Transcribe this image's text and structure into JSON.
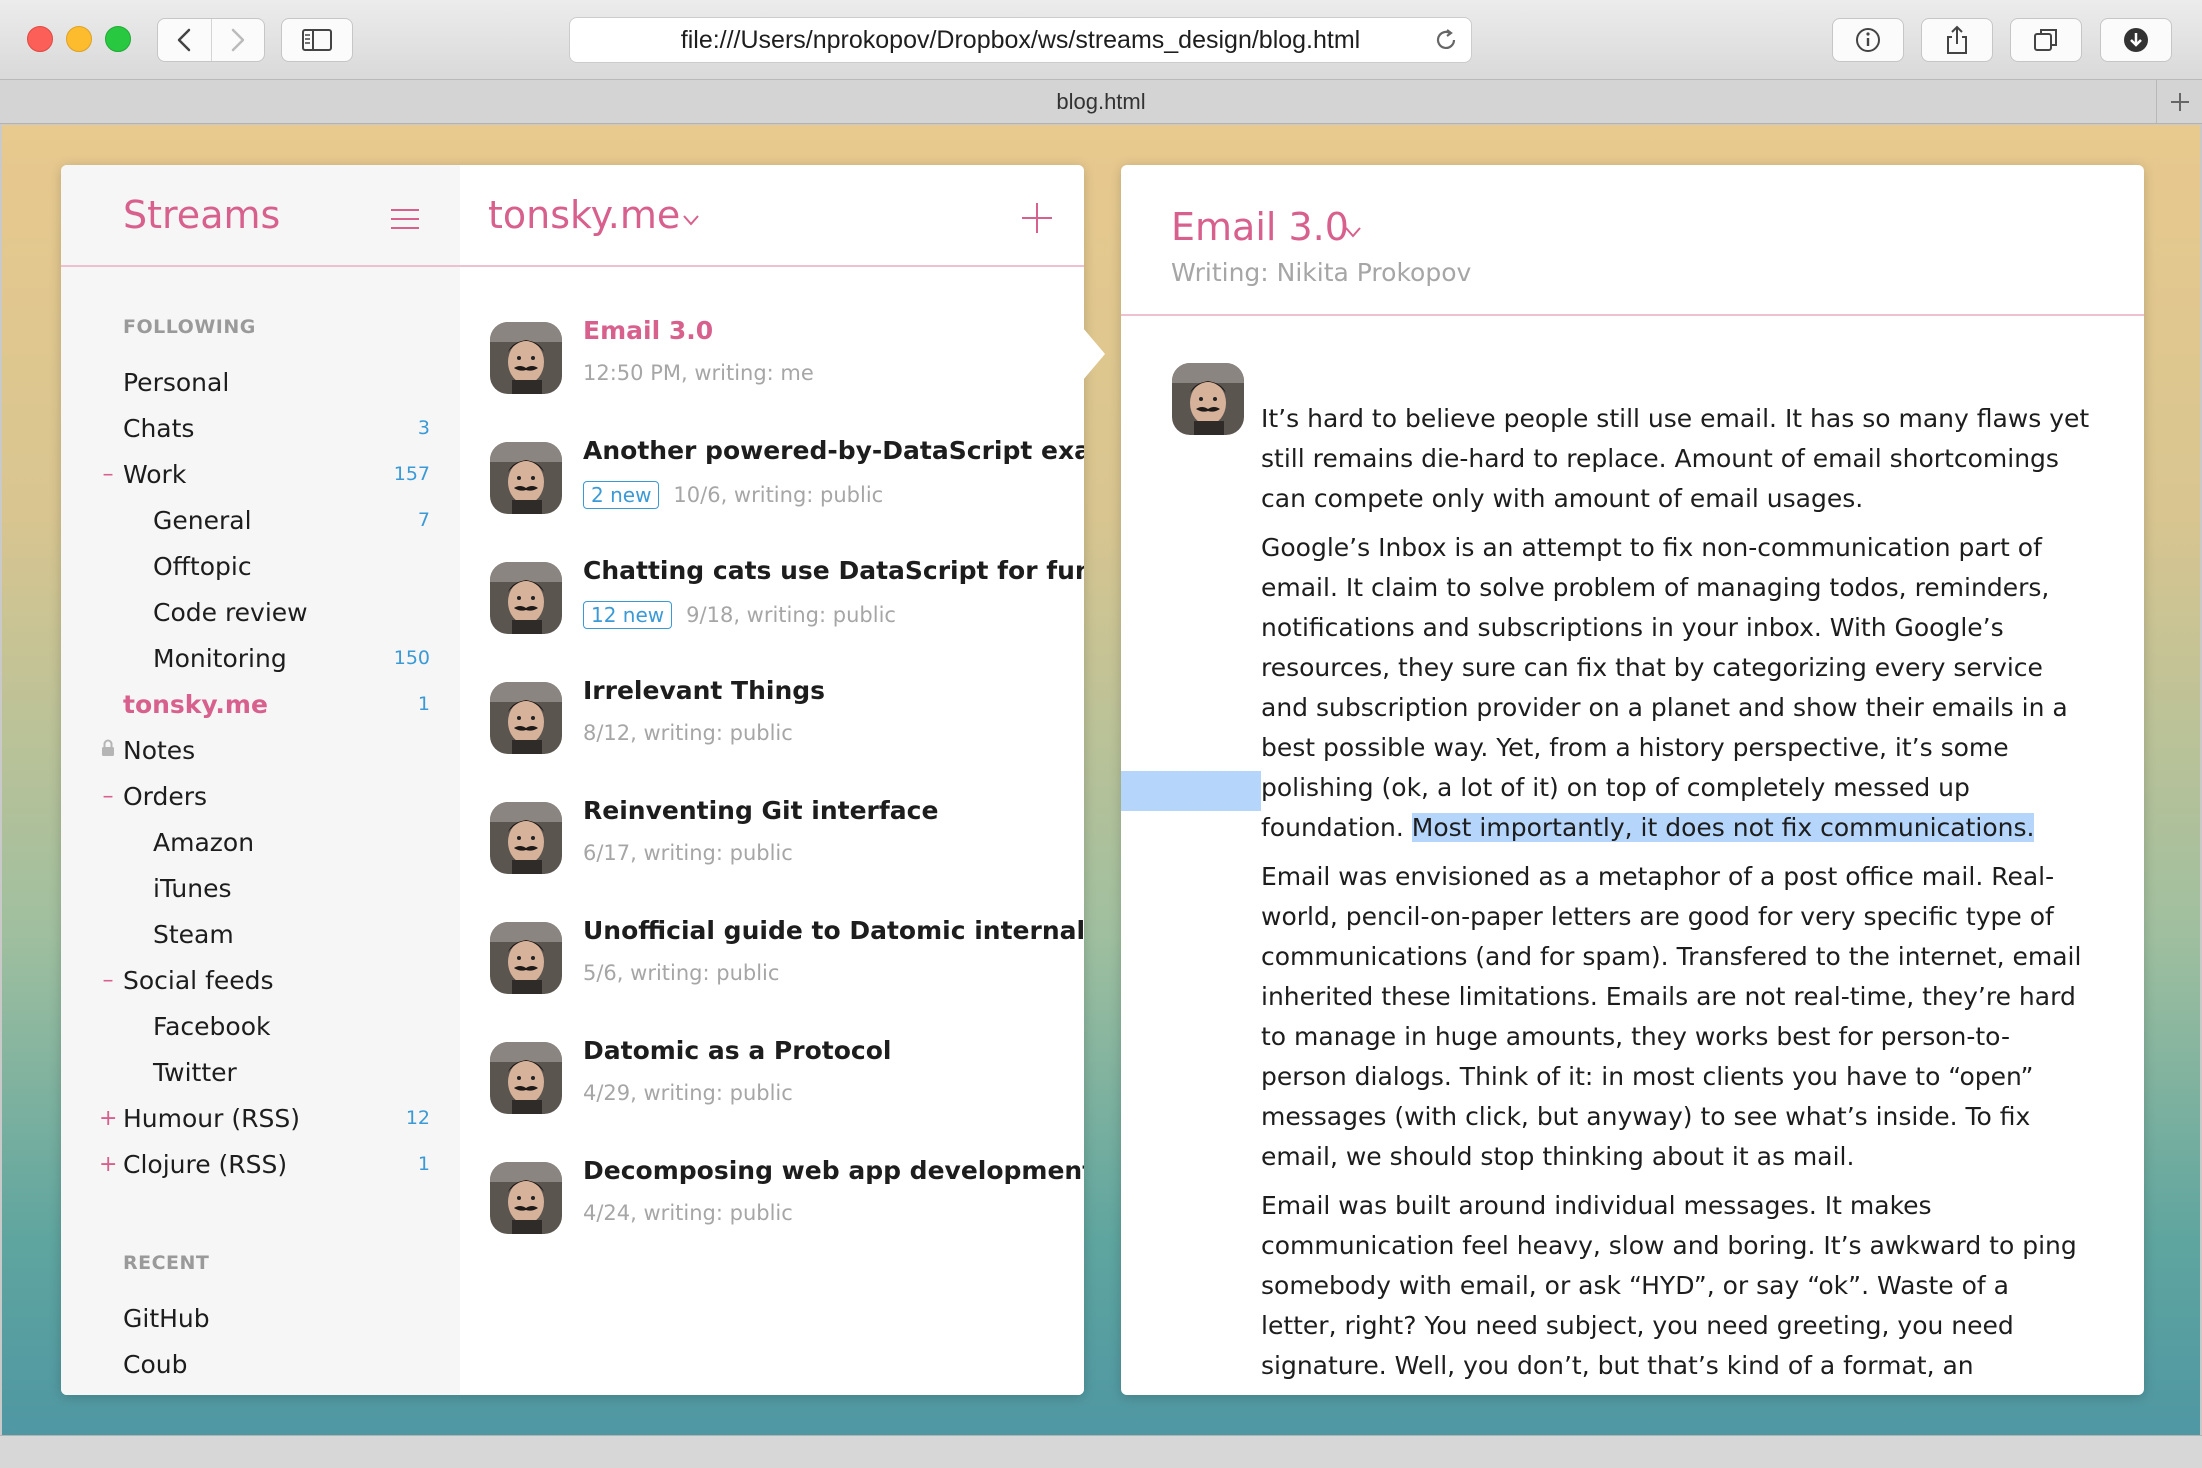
{
  "browser": {
    "url": "file:///Users/nprokopov/Dropbox/ws/streams_design/blog.html",
    "tab_title": "blog.html"
  },
  "sidebar": {
    "title": "Streams",
    "following_label": "FOLLOWING",
    "items": [
      {
        "prefix": "",
        "label": "Personal",
        "count": ""
      },
      {
        "prefix": "",
        "label": "Chats",
        "count": "3"
      },
      {
        "prefix": "–",
        "label": "Work",
        "count": "157"
      },
      {
        "prefix": "",
        "label": "General",
        "count": "7"
      },
      {
        "prefix": "",
        "label": "Offtopic",
        "count": ""
      },
      {
        "prefix": "",
        "label": "Code review",
        "count": ""
      },
      {
        "prefix": "",
        "label": "Monitoring",
        "count": "150"
      },
      {
        "prefix": "",
        "label": "tonsky.me",
        "count": "1"
      },
      {
        "prefix": "lock-icon",
        "label": "Notes",
        "count": ""
      },
      {
        "prefix": "–",
        "label": "Orders",
        "count": ""
      },
      {
        "prefix": "",
        "label": "Amazon",
        "count": ""
      },
      {
        "prefix": "",
        "label": "iTunes",
        "count": ""
      },
      {
        "prefix": "",
        "label": "Steam",
        "count": ""
      },
      {
        "prefix": "–",
        "label": "Social feeds",
        "count": ""
      },
      {
        "prefix": "",
        "label": "Facebook",
        "count": ""
      },
      {
        "prefix": "",
        "label": "Twitter",
        "count": ""
      },
      {
        "prefix": "+",
        "label": "Humour (RSS)",
        "count": "12"
      },
      {
        "prefix": "+",
        "label": "Clojure (RSS)",
        "count": "1"
      }
    ],
    "recent_label": "RECENT",
    "recent": [
      {
        "label": "GitHub"
      },
      {
        "label": "Coub"
      }
    ]
  },
  "stream": {
    "title": "tonsky.me",
    "posts": [
      {
        "title": "Email 3.0",
        "badge": "",
        "meta": "12:50 PM, writing: me"
      },
      {
        "title": "Another powered-by-DataScript exa...",
        "badge": "2 new",
        "meta": "10/6, writing: public"
      },
      {
        "title": "Chatting cats use DataScript for fun",
        "badge": "12 new",
        "meta": "9/18, writing: public"
      },
      {
        "title": "Irrelevant Things",
        "badge": "",
        "meta": "8/12, writing: public"
      },
      {
        "title": "Reinventing Git interface",
        "badge": "",
        "meta": "6/17, writing: public"
      },
      {
        "title": "Unofficial guide to Datomic internals",
        "badge": "",
        "meta": "5/6, writing: public"
      },
      {
        "title": "Datomic as a Protocol",
        "badge": "",
        "meta": "4/29, writing: public"
      },
      {
        "title": "Decomposing web app development",
        "badge": "",
        "meta": "4/24, writing: public"
      }
    ]
  },
  "document": {
    "title": "Email 3.0",
    "subtitle": "Writing: Nikita Prokopov",
    "p1": "It’s hard to believe people still use email. It has so many flaws yet still remains die-hard to replace. Amount of email shortcomings can compete only with amount of email usages.",
    "p2_a": "Google’s Inbox is an attempt to fix non-communication part of email. It claim to solve problem of managing todos, reminders, notifications and subscriptions in your inbox. With Google’s resources, they sure can fix that by categorizing every service and subscription provider on a planet and show their emails in a best possible way. Yet, from a history perspective, it’s some polishing (ok, a lot of it) on top of completely messed up foundation. ",
    "p2_highlight": "Most importantly, it does not fix communications.",
    "p3": "Email was envisioned as a metaphor of a post office mail. Real-world, pencil-on-paper letters are good for very specific type of communications (and for spam). Transfered to the internet, email inherited these limitations. Emails are not real-time, they’re hard to manage in huge amounts, they works best for person-to-person dialogs. Think of it: in most clients you have to “open” messages (with click, but anyway) to see what’s inside. To fix email, we should stop thinking about it as mail.",
    "p4": "Email was built around individual messages. It makes communication feel heavy, slow and boring. It’s awkward to ping somebody with email, or ask “HYD”, or say “ok”. Waste of a letter, right? You need subject, you need greeting, you need signature. Well, you don’t, but that’s kind of a format, an etiquette."
  },
  "colors": {
    "accent": "#d8608d",
    "link": "#3b9ad6",
    "selection": "#b5d5fb"
  }
}
